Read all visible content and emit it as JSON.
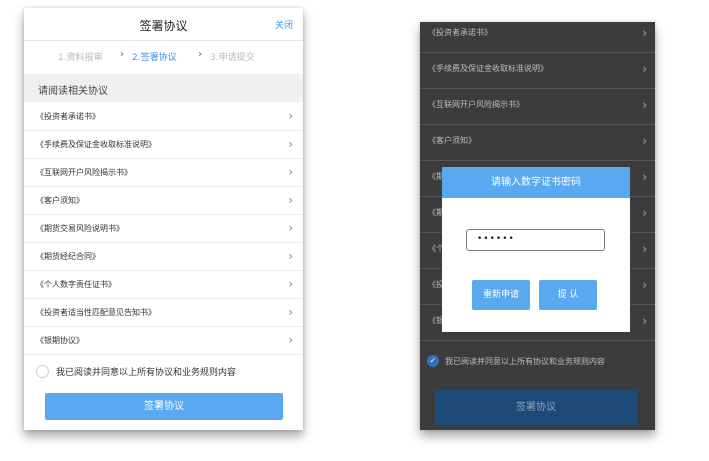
{
  "left": {
    "title": "签署协议",
    "close": "关闭",
    "steps": [
      "1.资料报审",
      "2.签署协议",
      "3.申请提交"
    ],
    "section": "请阅读相关协议",
    "items": [
      "《投资者承诺书》",
      "《手续费及保证金收取标准说明》",
      "《互联网开户风险揭示书》",
      "《客户须知》",
      "《期货交易风险说明书》",
      "《期货经纪合同》",
      "《个人数字责任证书》",
      "《投资者适当性匹配意见告知书》",
      "《银期协议》"
    ],
    "agree": "我已阅读并同意以上所有协议和业务规则内容",
    "button": "签署协议"
  },
  "right": {
    "items": [
      "《投资者承诺书》",
      "《手续费及保证金收取标准说明》",
      "《互联网开户风险揭示书》",
      "《客户须知》",
      "《期",
      "《期",
      "《个",
      "《投",
      "《银"
    ],
    "agree": "我已阅读并同意以上所有协议和业务规则内容",
    "button": "签署协议",
    "modal": {
      "title": "请输入数字证书密码",
      "password": "••••••",
      "reset": "重新申请",
      "confirm": "提 认"
    }
  },
  "colors": {
    "accent": "#5aa8f0",
    "link": "#3f95e8",
    "dark_bg": "#3c3c3c"
  }
}
